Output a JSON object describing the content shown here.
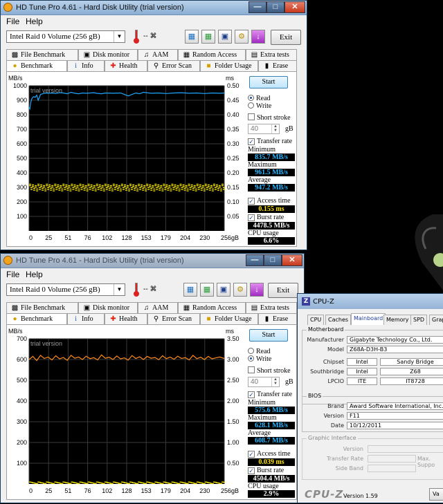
{
  "windows": [
    {
      "title": "HD Tune Pro 4.61 - Hard Disk Utility (trial version)",
      "menu": [
        "File",
        "Help"
      ],
      "drive": "Intel  Raid 0 Volume (256 gB)",
      "temperature": "-- ⌘",
      "exit_label": "Exit",
      "tabs_top": [
        "File Benchmark",
        "Disk monitor",
        "AAM",
        "Random Access",
        "Extra tests"
      ],
      "tabs_bottom": [
        "Benchmark",
        "Info",
        "Health",
        "Error Scan",
        "Folder Usage",
        "Erase"
      ],
      "start_label": "Start",
      "read_label": "Read",
      "write_label": "Write",
      "mode": "read",
      "short_stroke_label": "Short stroke",
      "short_stroke_value": "40",
      "short_stroke_unit": "gB",
      "transfer_rate_label": "Transfer rate",
      "minimum_label": "Minimum",
      "minimum": "835.7 MB/s",
      "maximum_label": "Maximum",
      "maximum": "961.5 MB/s",
      "average_label": "Average",
      "average": "947.2 MB/s",
      "access_time_label": "Access time",
      "access_time": "0.155 ms",
      "burst_rate_label": "Burst rate",
      "burst_rate": "4478.5 MB/s",
      "cpu_usage_label": "CPU usage",
      "cpu_usage": "6.6%",
      "chart_data": {
        "type": "line",
        "watermark": "trial version",
        "ylabel_left": "MB/s",
        "ylabel_right": "ms",
        "y_ticks_left": [
          "1000",
          "900",
          "800",
          "700",
          "600",
          "500",
          "400",
          "300",
          "200",
          "100"
        ],
        "y_ticks_right": [
          "0.50",
          "0.45",
          "0.40",
          "0.35",
          "0.30",
          "0.25",
          "0.20",
          "0.15",
          "0.10",
          "0.05"
        ],
        "x_ticks": [
          "0",
          "25",
          "51",
          "76",
          "102",
          "128",
          "153",
          "179",
          "204",
          "230",
          "256gB"
        ],
        "ylim_left": [
          0,
          1000
        ],
        "ylim_right": [
          0,
          0.5
        ],
        "xlim": [
          0,
          256
        ],
        "series": [
          {
            "type": "line",
            "color": "#1ea8ff",
            "x": [
              0,
              1,
              2,
              3,
              4,
              6,
              8,
              10,
              12,
              15,
              18,
              21,
              25,
              30,
              35,
              40,
              45,
              50,
              55,
              60,
              65,
              70,
              75,
              80,
              85,
              90,
              95,
              100,
              110,
              120,
              130,
              140,
              145,
              150,
              160,
              170,
              180,
              190,
              200,
              210,
              220,
              230,
              240,
              250,
              256
            ],
            "y": [
              850,
              840,
              880,
              900,
              915,
              925,
              920,
              935,
              900,
              940,
              945,
              950,
              948,
              950,
              946,
              952,
              950,
              945,
              955,
              948,
              945,
              950,
              948,
              950,
              952,
              947,
              945,
              950,
              948,
              950,
              930,
              950,
              945,
              955,
              948,
              950,
              946,
              950,
              952,
              948,
              950,
              946,
              950,
              948,
              950
            ]
          },
          {
            "type": "scatter",
            "color": "#ffee00",
            "band_values": [
              0.155,
              0.148,
              0.16,
              0.142
            ]
          }
        ]
      }
    },
    {
      "title": "HD Tune Pro 4.61 - Hard Disk Utility (trial version)",
      "menu": [
        "File",
        "Help"
      ],
      "drive": "Intel  Raid 0 Volume (256 gB)",
      "temperature": "-- ⌘",
      "exit_label": "Exit",
      "tabs_top": [
        "File Benchmark",
        "Disk monitor",
        "AAM",
        "Random Access",
        "Extra tests"
      ],
      "tabs_bottom": [
        "Benchmark",
        "Info",
        "Health",
        "Error Scan",
        "Folder Usage",
        "Erase"
      ],
      "start_label": "Start",
      "read_label": "Read",
      "write_label": "Write",
      "mode": "write",
      "short_stroke_label": "Short stroke",
      "short_stroke_value": "40",
      "short_stroke_unit": "gB",
      "transfer_rate_label": "Transfer rate",
      "minimum_label": "Minimum",
      "minimum": "575.6 MB/s",
      "maximum_label": "Maximum",
      "maximum": "628.1 MB/s",
      "average_label": "Average",
      "average": "608.7 MB/s",
      "access_time_label": "Access time",
      "access_time": "0.039 ms",
      "burst_rate_label": "Burst rate",
      "burst_rate": "4504.4 MB/s",
      "cpu_usage_label": "CPU usage",
      "cpu_usage": "2.9%",
      "chart_data": {
        "type": "line",
        "watermark": "trial version",
        "ylabel_left": "MB/s",
        "ylabel_right": "ms",
        "y_ticks_left": [
          "700",
          "600",
          "500",
          "400",
          "300",
          "200",
          "100"
        ],
        "y_ticks_right": [
          "3.50",
          "3.00",
          "2.50",
          "2.00",
          "1.50",
          "1.00",
          "0.50"
        ],
        "x_ticks": [
          "0",
          "25",
          "51",
          "76",
          "102",
          "128",
          "153",
          "179",
          "204",
          "230",
          "256gB"
        ],
        "ylim_left": [
          0,
          700
        ],
        "ylim_right": [
          0,
          3.5
        ],
        "xlim": [
          0,
          256
        ],
        "series": [
          {
            "type": "line",
            "color": "#ff8a1a",
            "x": [
              0,
              5,
              10,
              15,
              20,
              25,
              30,
              35,
              40,
              45,
              50,
              55,
              60,
              65,
              70,
              75,
              80,
              85,
              90,
              95,
              100,
              105,
              110,
              115,
              120,
              125,
              130,
              135,
              140,
              145,
              150,
              155,
              160,
              165,
              170,
              175,
              180,
              185,
              190,
              195,
              200,
              205,
              210,
              215,
              220,
              225,
              230,
              235,
              240,
              245,
              250,
              256
            ],
            "y": [
              600,
              615,
              595,
              620,
              605,
              612,
              598,
              618,
              603,
              610,
              596,
              620,
              606,
              612,
              600,
              616,
              604,
              609,
              598,
              622,
              606,
              611,
              600,
              617,
              603,
              608,
              597,
              619,
              605,
              613,
              600,
              615,
              606,
              610,
              599,
              618,
              604,
              612,
              601,
              616,
              605,
              609,
              598,
              620,
              604,
              611,
              600,
              615,
              603,
              608,
              612,
              605
            ]
          },
          {
            "type": "scatter",
            "color": "#ffee00",
            "band_values": [
              0.04,
              0.035
            ]
          }
        ]
      }
    }
  ],
  "cpuz": {
    "title": "CPU-Z",
    "tabs": [
      "CPU",
      "Caches",
      "Mainboard",
      "Memory",
      "SPD",
      "Grap"
    ],
    "active_tab": "Mainboard",
    "motherboard_title": "Motherboard",
    "manufacturer_label": "Manufacturer",
    "manufacturer": "Gigabyte Technology Co., Ltd.",
    "model_label": "Model",
    "model": "Z68A-D3H-B3",
    "chipset_label": "Chipset",
    "chipset_vendor": "Intel",
    "chipset_name": "Sandy Bridge",
    "southbridge_label": "Southbridge",
    "southbridge_vendor": "Intel",
    "southbridge_name": "Z68",
    "lpcio_label": "LPCIO",
    "lpcio_vendor": "ITE",
    "lpcio_name": "IT8728",
    "bios_title": "BIOS",
    "brand_label": "Brand",
    "brand": "Award Software International, Inc.",
    "version_label": "Version",
    "version": "F11",
    "date_label": "Date",
    "date": "10/12/2011",
    "graphic_title": "Graphic Interface",
    "gi_version_label": "Version",
    "gi_transfer_label": "Transfer Rate",
    "gi_max_label": "Max. Suppo",
    "gi_side_label": "Side Band",
    "logo": "CPU-Z",
    "app_version": "Version 1.59",
    "validate_label": "Va"
  }
}
